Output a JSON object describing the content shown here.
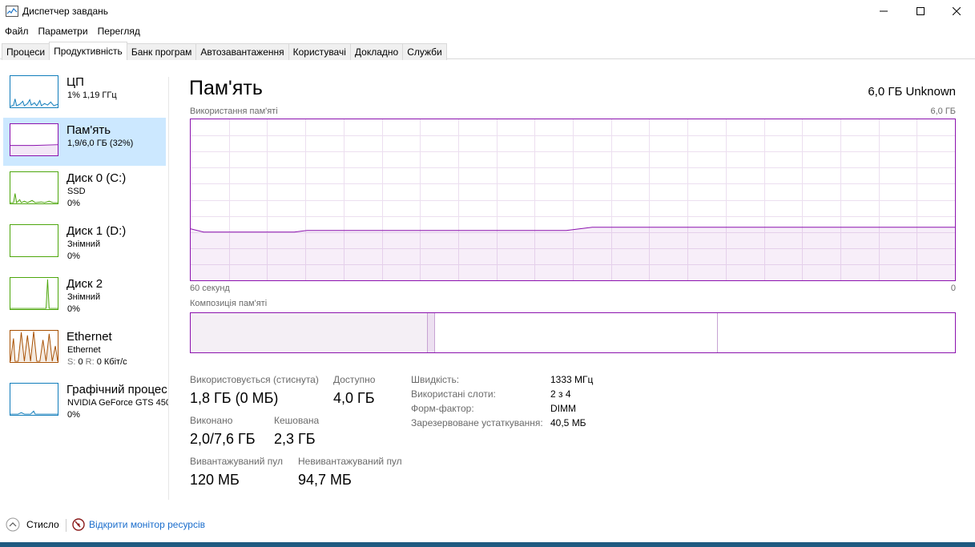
{
  "window": {
    "title": "Диспетчер завдань"
  },
  "menu": [
    "Файл",
    "Параметри",
    "Перегляд"
  ],
  "tabs": [
    "Процеси",
    "Продуктивність",
    "Банк програм",
    "Автозавантаження",
    "Користувачі",
    "Докладно",
    "Служби"
  ],
  "sidebar": [
    {
      "title": "ЦП",
      "sub1": "1%  1,19 ГГц",
      "sub2": "",
      "color": "#117dbb"
    },
    {
      "title": "Пам'ять",
      "sub1": "1,9/6,0 ГБ (32%)",
      "sub2": "",
      "color": "#8b12ae"
    },
    {
      "title": "Диск 0 (C:)",
      "sub1": "SSD",
      "sub2": "0%",
      "color": "#4da60c"
    },
    {
      "title": "Диск 1 (D:)",
      "sub1": "Знімний",
      "sub2": "0%",
      "color": "#4da60c"
    },
    {
      "title": "Диск 2",
      "sub1": "Знімний",
      "sub2": "0%",
      "color": "#4da60c"
    },
    {
      "title": "Ethernet",
      "sub1": "Ethernet",
      "sub2_s": "S:",
      "sub2_s_val": "0",
      "sub2_r": "R:",
      "sub2_r_val": "0 Кбіт/с",
      "color": "#a74f01"
    },
    {
      "title": "Графічний процес",
      "sub1": "NVIDIA GeForce GTS 450",
      "sub2": "0%",
      "color": "#117dbb"
    }
  ],
  "main": {
    "title": "Пам'ять",
    "spec": "6,0 ГБ Unknown",
    "usage_label": "Використання пам'яті",
    "usage_max": "6,0 ГБ",
    "time_left": "60 секунд",
    "time_right": "0",
    "composition_label": "Композиція пам'яті",
    "usage_history_percent": [
      32,
      30,
      30,
      30,
      30,
      30,
      30,
      30,
      30,
      31,
      31,
      31,
      31,
      31,
      31,
      31,
      31,
      31,
      31,
      31,
      31,
      31,
      31,
      31,
      31,
      31,
      31,
      31,
      31,
      31,
      32,
      33,
      33,
      33,
      33,
      33,
      33,
      33,
      33,
      33,
      33,
      33,
      33,
      33,
      33,
      33,
      33,
      33,
      33,
      33,
      33,
      33,
      33,
      33,
      33,
      33,
      33,
      33,
      33,
      33
    ],
    "composition": {
      "in_use_percent": 31,
      "modified_percent": 1,
      "standby_percent": 37
    },
    "stats": {
      "in_use_label": "Використовується (стиснута)",
      "in_use_value": "1,8 ГБ (0 МБ)",
      "available_label": "Доступно",
      "available_value": "4,0 ГБ",
      "committed_label": "Виконано",
      "committed_value": "2,0/7,6 ГБ",
      "cached_label": "Кешована",
      "cached_value": "2,3 ГБ",
      "paged_label": "Вивантажуваний пул",
      "paged_value": "120 МБ",
      "nonpaged_label": "Невивантажуваний пул",
      "nonpaged_value": "94,7 МБ"
    },
    "details": [
      {
        "key": "Швидкість:",
        "value": "1333 МГц"
      },
      {
        "key": "Використані слоти:",
        "value": "2 з 4"
      },
      {
        "key": "Форм-фактор:",
        "value": "DIMM"
      },
      {
        "key": "Зарезервоване устаткування:",
        "value": "40,5 МБ"
      }
    ]
  },
  "footer": {
    "less_label": "Стисло",
    "monitor_link": "Відкрити монітор ресурсів"
  },
  "colors": {
    "memory": "#8b12ae",
    "cpu": "#117dbb",
    "disk": "#4da60c",
    "ethernet": "#a74f01",
    "selected": "#cce8ff"
  }
}
